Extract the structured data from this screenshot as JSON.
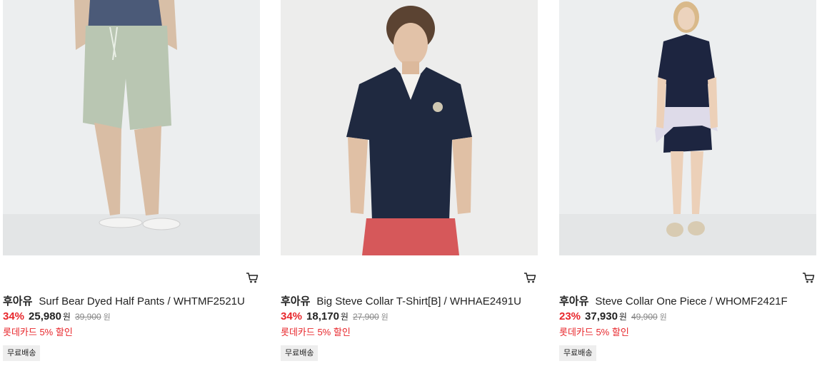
{
  "colors": {
    "discount_red": "#e8262b",
    "badge_bg": "#eeeeee"
  },
  "products": [
    {
      "image_alt": "Surf Bear Dyed Half Pants",
      "brand": "후아유",
      "name": "Surf Bear Dyed Half Pants / WHTMF2521U",
      "discount": "34%",
      "price": "25,980",
      "currency": "원",
      "original_price": "39,900",
      "card_discount": "롯데카드 5% 할인",
      "badge": "무료배송",
      "cart_icon": "cart-icon"
    },
    {
      "image_alt": "Big Steve Collar T-Shirt[B]",
      "brand": "후아유",
      "name": "Big Steve Collar T-Shirt[B] / WHHAE2491U",
      "discount": "34%",
      "price": "18,170",
      "currency": "원",
      "original_price": "27,900",
      "card_discount": "롯데카드 5% 할인",
      "badge": "무료배송",
      "cart_icon": "cart-icon"
    },
    {
      "image_alt": "Steve Collar One Piece",
      "brand": "후아유",
      "name": "Steve Collar One Piece / WHOMF2421F",
      "discount": "23%",
      "price": "37,930",
      "currency": "원",
      "original_price": "49,900",
      "card_discount": "롯데카드 5% 할인",
      "badge": "무료배송",
      "cart_icon": "cart-icon"
    }
  ]
}
